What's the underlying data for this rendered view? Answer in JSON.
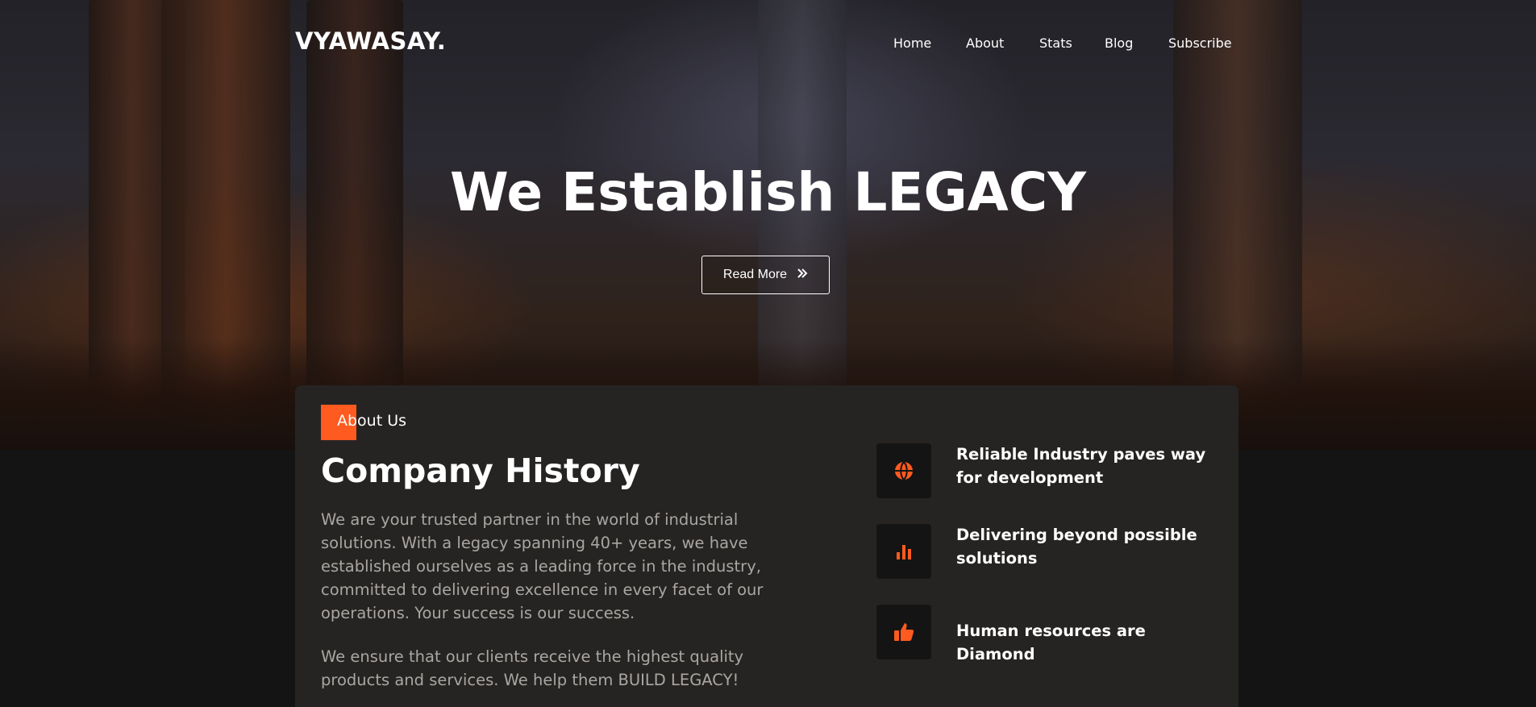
{
  "header": {
    "logo": "VYAWASAY.",
    "nav": [
      "Home",
      "About",
      "Stats",
      "Blog",
      "Subscribe"
    ]
  },
  "hero": {
    "title": "We Establish LEGACY",
    "button_label": "Read More",
    "button_icon": "double-chevron-right-icon"
  },
  "about": {
    "badge": "About Us",
    "title": "Company History",
    "paragraphs": [
      "We are your trusted partner in the world of industrial solutions. With a legacy spanning 40+ years, we have established ourselves as a leading force in the industry, committed to delivering excellence in every facet of our operations. Your success is our success.",
      "We ensure that our clients receive the highest quality products and services. We help them BUILD LEGACY!"
    ],
    "features": [
      {
        "icon": "globe-icon",
        "text": "Reliable Industry paves way for development"
      },
      {
        "icon": "bar-chart-icon",
        "text": "Delivering beyond possible solutions"
      },
      {
        "icon": "thumbs-up-icon",
        "text": "Human resources are Diamond"
      }
    ]
  },
  "colors": {
    "accent": "#ff5a1f",
    "card_bg": "#262422",
    "page_bg": "#141414",
    "icon_box_bg": "#141414",
    "muted_text": "#a9a6a3"
  }
}
